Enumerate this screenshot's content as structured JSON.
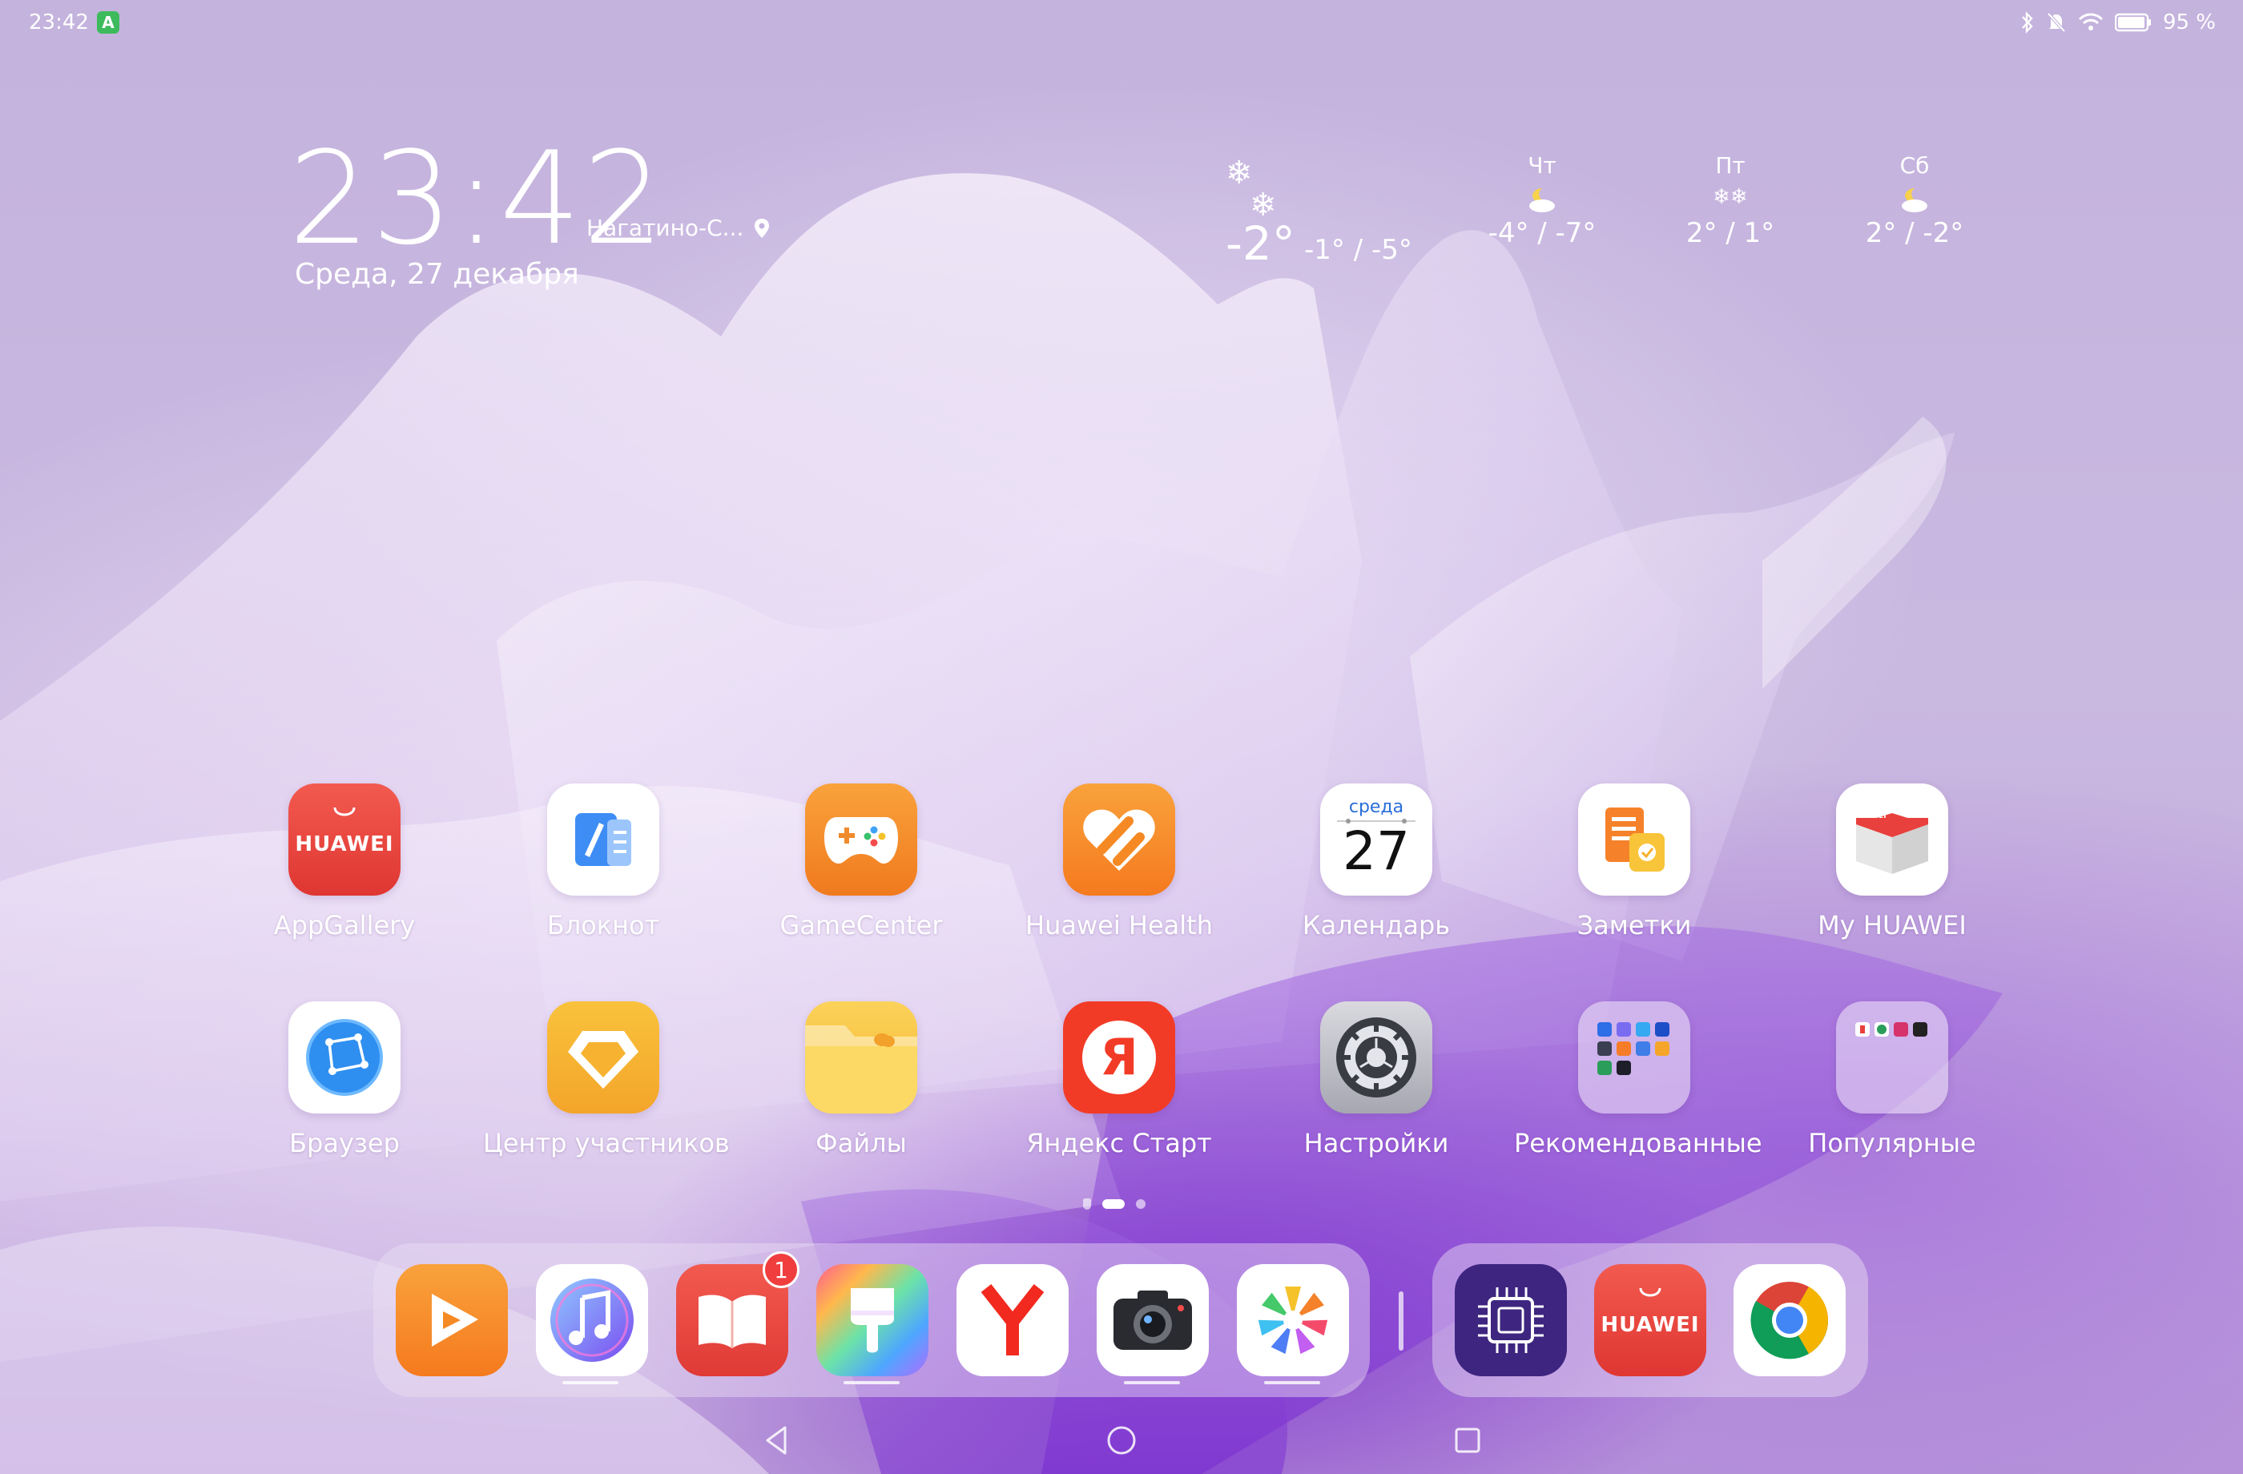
{
  "status_bar": {
    "time": "23:42",
    "notification_icon": "app-notification-icon",
    "battery": "95 %"
  },
  "clock_widget": {
    "time": "23:42",
    "location": "Нагатино-С...",
    "date": "Среда, 27 декабря"
  },
  "weather": {
    "now": {
      "temp": "-2°",
      "range": "-1° / -5°",
      "icon": "snow-icon"
    },
    "forecast": [
      {
        "day": "Чт",
        "range": "-4° / -7°",
        "icon": "partly-cloudy-night-icon"
      },
      {
        "day": "Пт",
        "range": "2° / 1°",
        "icon": "snow-icon"
      },
      {
        "day": "Сб",
        "range": "2° / -2°",
        "icon": "partly-cloudy-night-icon"
      }
    ]
  },
  "apps_row1": [
    {
      "label": "AppGallery",
      "icon": "appgallery-icon",
      "text": "HUAWEI"
    },
    {
      "label": "Блокнот",
      "icon": "notepad-icon"
    },
    {
      "label": "GameCenter",
      "icon": "gamecenter-icon"
    },
    {
      "label": "Huawei Health",
      "icon": "health-icon"
    },
    {
      "label": "Календарь",
      "icon": "calendar-icon",
      "weekday": "среда",
      "day": "27"
    },
    {
      "label": "Заметки",
      "icon": "notes-icon"
    },
    {
      "label": "My HUAWEI",
      "icon": "my-huawei-icon",
      "text": "HUAWEI"
    }
  ],
  "apps_row2": [
    {
      "label": "Браузер",
      "icon": "browser-icon"
    },
    {
      "label": "Центр участников",
      "icon": "member-center-icon"
    },
    {
      "label": "Файлы",
      "icon": "files-icon"
    },
    {
      "label": "Яндекс Старт",
      "icon": "yandex-start-icon",
      "text": "Я"
    },
    {
      "label": "Настройки",
      "icon": "settings-icon"
    },
    {
      "label": "Рекомендованные",
      "icon": "folder-icon"
    },
    {
      "label": "Популярные",
      "icon": "folder-icon"
    }
  ],
  "dock": {
    "apps": [
      {
        "name": "video",
        "icon": "video-icon"
      },
      {
        "name": "music",
        "icon": "music-icon"
      },
      {
        "name": "books",
        "icon": "books-icon",
        "badge": "1"
      },
      {
        "name": "themes",
        "icon": "themes-icon"
      },
      {
        "name": "yandex-browser",
        "icon": "yandex-browser-icon"
      },
      {
        "name": "camera",
        "icon": "camera-icon"
      },
      {
        "name": "gallery",
        "icon": "gallery-icon"
      }
    ],
    "recent": [
      {
        "name": "cpu",
        "icon": "cpu-icon"
      },
      {
        "name": "appgallery",
        "icon": "appgallery-icon",
        "text": "HUAWEI"
      },
      {
        "name": "chrome",
        "icon": "chrome-icon"
      }
    ]
  },
  "colors": {
    "appgallery": "#e8403c",
    "orange": "#f5952a",
    "yandex_red": "#f23b27",
    "purple": "#5a2fa0"
  }
}
